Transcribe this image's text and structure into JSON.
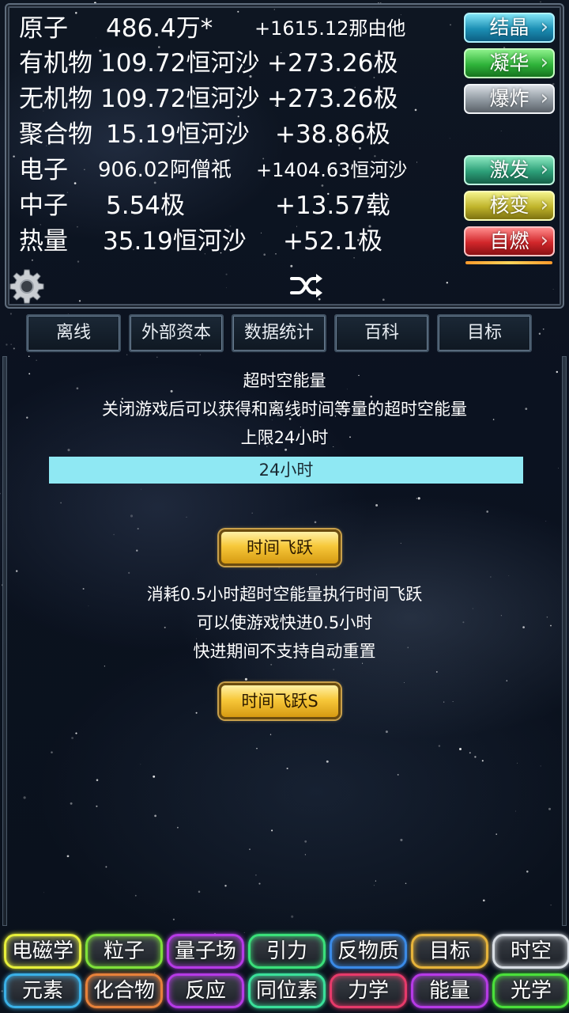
{
  "resources": [
    {
      "name": "原子",
      "amount": "486.4万*",
      "rate": "+1615.12那由他"
    },
    {
      "name": "有机物",
      "amount": "109.72恒河沙",
      "rate": "+273.26极"
    },
    {
      "name": "无机物",
      "amount": "109.72恒河沙",
      "rate": "+273.26极"
    },
    {
      "name": "聚合物",
      "amount": "15.19恒河沙",
      "rate": "+38.86极"
    },
    {
      "name": "电子",
      "amount": "906.02阿僧祇",
      "rate": "+1404.63恒河沙"
    },
    {
      "name": "中子",
      "amount": "5.54极",
      "rate": "+13.57载"
    },
    {
      "name": "热量",
      "amount": "35.19恒河沙",
      "rate": "+52.1极"
    }
  ],
  "side_buttons": [
    "结晶",
    "凝华",
    "爆炸",
    "激发",
    "核变",
    "自燃"
  ],
  "tabs": [
    "离线",
    "外部资本",
    "数据统计",
    "百科",
    "目标"
  ],
  "offline": {
    "title": "超时空能量",
    "desc": "关闭游戏后可以获得和离线时间等量的超时空能量",
    "limit": "上限24小时",
    "bar_label": "24小时",
    "bar_fill": 1.0,
    "jump_button": "时间飞跃",
    "jump_desc_1": "消耗0.5小时超时空能量执行时间飞跃",
    "jump_desc_2": "可以使游戏快进0.5小时",
    "jump_desc_3": "快进期间不支持自动重置",
    "jump_s_button": "时间飞跃S"
  },
  "bottom_row_1": [
    "电磁学",
    "粒子",
    "量子场",
    "引力",
    "反物质",
    "目标",
    "时空"
  ],
  "bottom_row_2": [
    "元素",
    "化合物",
    "反应",
    "同位素",
    "力学",
    "能量",
    "光学"
  ],
  "colors": {
    "bottom_row_1": [
      "#e6ef3a",
      "#7fe03a",
      "#b63ae6",
      "#3ae07a",
      "#3a8ae6",
      "#e6b33a",
      "#d8dde3"
    ],
    "bottom_row_2": [
      "#3ab0e6",
      "#e6813a",
      "#b63ae6",
      "#3ae09a",
      "#e63a6a",
      "#b63ae6",
      "#4ae03a"
    ],
    "progress_fill": "#8fe8f3"
  },
  "icons": {
    "settings": "gear-icon",
    "shuffle": "shuffle-icon"
  }
}
